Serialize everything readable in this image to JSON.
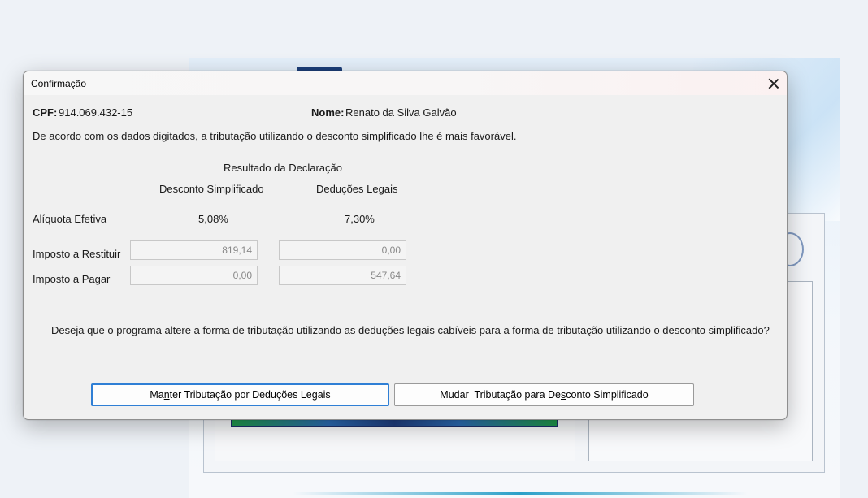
{
  "dialog": {
    "title": "Confirmação",
    "cpf_label": "CPF:",
    "cpf_value": "914.069.432-15",
    "nome_label": "Nome:",
    "nome_value": "Renato da Silva Galvão",
    "intro": "De acordo com os dados digitados, a tributação utilizando o desconto simplificado lhe é mais favorável.",
    "result_header": "Resultado da Declaração",
    "col_simplificado": "Desconto Simplificado",
    "col_legais": "Deduções Legais",
    "aliquota_label": "Alíquota Efetiva",
    "aliquota_simplificado": "5,08%",
    "aliquota_legais": "7,30%",
    "restituir_label": "Imposto a Restituir",
    "restituir_simplificado": "819,14",
    "restituir_legais": "0,00",
    "pagar_label": "Imposto a Pagar",
    "pagar_simplificado": "0,00",
    "pagar_legais": "547,64",
    "question": "Deseja que o programa altere a forma de tributação utilizando as deduções legais cabíveis para a forma de tributação utilizando o desconto simplificado?",
    "btn_manter": {
      "before": "Ma",
      "mnemonic": "n",
      "after": "ter Tributação por Deduções Legais"
    },
    "btn_mudar": {
      "before": "Mudar  Tributação para De",
      "mnemonic": "s",
      "after": "conto Simplificado"
    }
  },
  "icons": {
    "close": "close-icon"
  }
}
